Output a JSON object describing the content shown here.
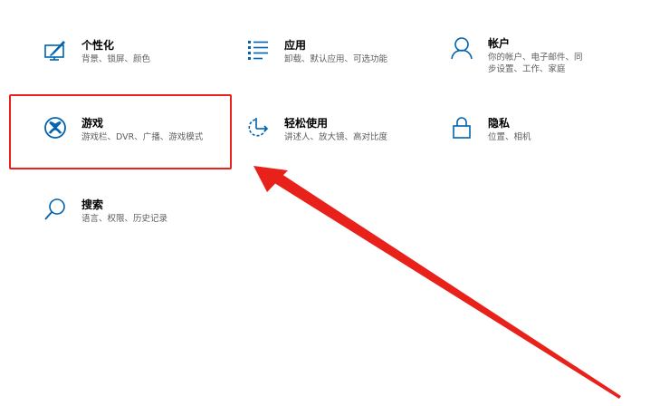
{
  "colors": {
    "accent": "#0063b1",
    "highlight": "#e8221b"
  },
  "tiles": [
    {
      "id": "personalization",
      "icon": "personalization-icon",
      "title": "个性化",
      "desc": "背景、锁屏、颜色"
    },
    {
      "id": "apps",
      "icon": "apps-list-icon",
      "title": "应用",
      "desc": "卸载、默认应用、可选功能"
    },
    {
      "id": "accounts",
      "icon": "person-icon",
      "title": "帐户",
      "desc": "你的帐户、电子邮件、同步设置、工作、家庭"
    },
    {
      "id": "gaming",
      "icon": "xbox-icon",
      "title": "游戏",
      "desc": "游戏栏、DVR、广播、游戏模式"
    },
    {
      "id": "ease",
      "icon": "ease-of-access-icon",
      "title": "轻松使用",
      "desc": "讲述人、放大镜、高对比度"
    },
    {
      "id": "privacy",
      "icon": "lock-icon",
      "title": "隐私",
      "desc": "位置、相机"
    },
    {
      "id": "search",
      "icon": "search-icon",
      "title": "搜索",
      "desc": "语言、权限、历史记录"
    }
  ]
}
